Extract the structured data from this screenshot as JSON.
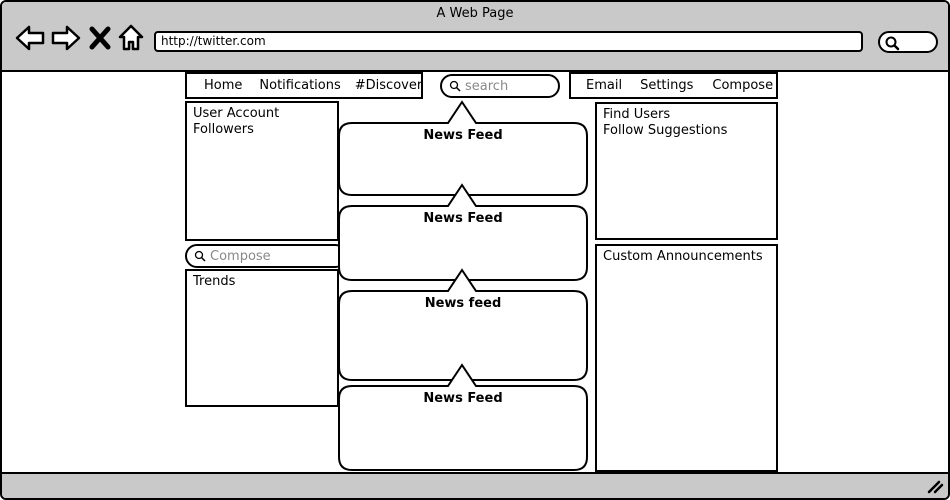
{
  "window": {
    "title": "A Web Page"
  },
  "browser": {
    "url": "http://twitter.com",
    "search_value": ""
  },
  "nav_left": {
    "home": "Home",
    "notifications": "Notifications",
    "discover": "#Discover"
  },
  "nav_search": {
    "placeholder": "search"
  },
  "nav_right": {
    "email": "Email",
    "settings": "Settings",
    "compose": "Compose"
  },
  "left_panel": {
    "user_account": "User Account",
    "followers": "Followers"
  },
  "compose_field": {
    "placeholder": "Compose"
  },
  "trends_panel": {
    "title": "Trends"
  },
  "feeds": [
    "News Feed",
    "News Feed",
    "News feed",
    "News Feed"
  ],
  "right_panel": {
    "find_users": "Find Users",
    "follow_suggestions": "Follow Suggestions"
  },
  "announcements_panel": {
    "title": "Custom Announcements"
  },
  "icons": [
    "back-arrow-icon",
    "forward-arrow-icon",
    "close-icon",
    "home-icon",
    "search-icon",
    "resize-grip-icon"
  ]
}
